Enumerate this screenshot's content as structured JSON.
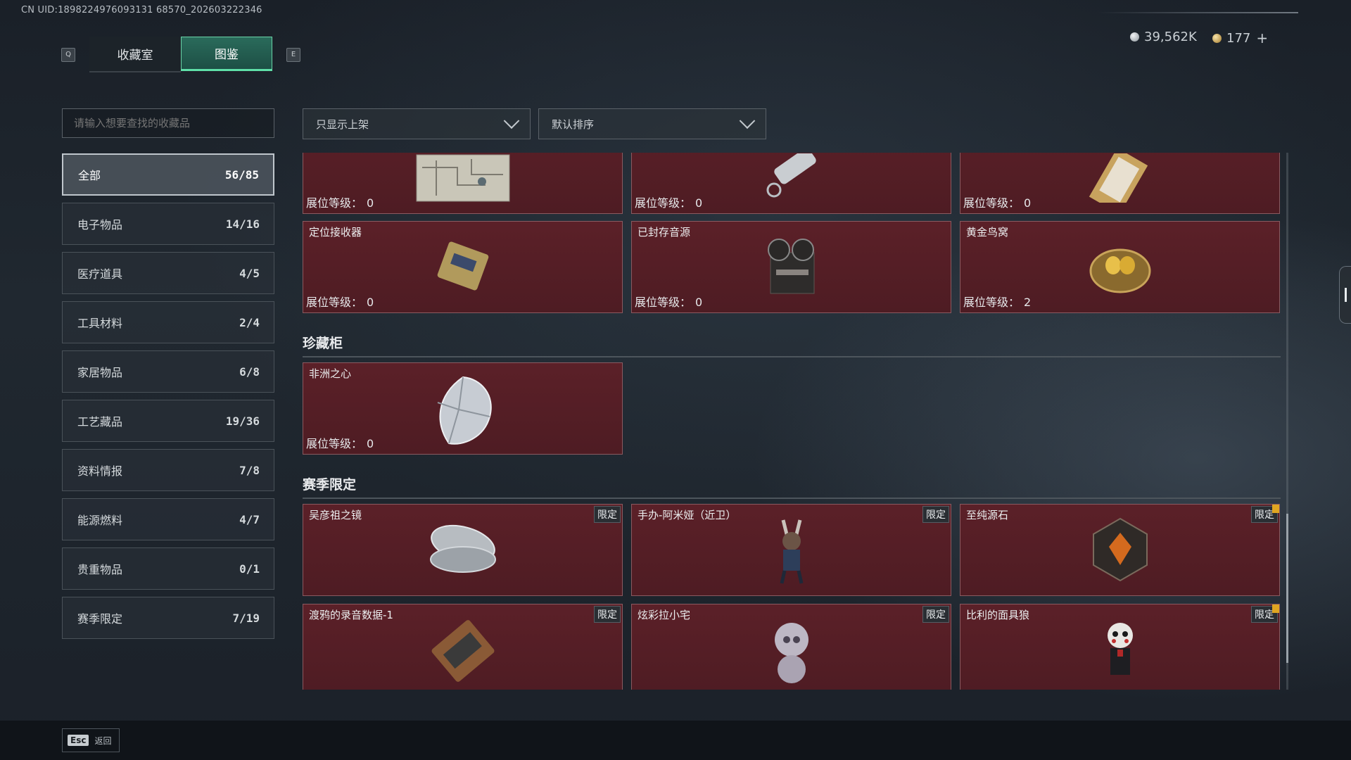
{
  "uid": "CN UID:1898224976093131 68570_202603222346",
  "keys": {
    "left": "Q",
    "right": "E",
    "esc": "Esc"
  },
  "tabs": [
    {
      "label": "收藏室"
    },
    {
      "label": "图鉴",
      "active": true
    }
  ],
  "currency": {
    "silver": "39,562K",
    "gold": "177",
    "plus": "+"
  },
  "search": {
    "placeholder": "请输入想要查找的收藏品"
  },
  "filters": {
    "display": "只显示上架",
    "sort": "默认排序"
  },
  "categories": [
    {
      "label": "全部",
      "count": "56/85",
      "active": true
    },
    {
      "label": "电子物品",
      "count": "14/16"
    },
    {
      "label": "医疗道具",
      "count": "4/5"
    },
    {
      "label": "工具材料",
      "count": "2/4"
    },
    {
      "label": "家居物品",
      "count": "6/8"
    },
    {
      "label": "工艺藏品",
      "count": "19/36"
    },
    {
      "label": "资料情报",
      "count": "7/8"
    },
    {
      "label": "能源燃料",
      "count": "4/7"
    },
    {
      "label": "贵重物品",
      "count": "0/1"
    },
    {
      "label": "赛季限定",
      "count": "7/19"
    }
  ],
  "level_label": "展位等级：",
  "limited_label": "限定",
  "top_row": [
    {
      "level": "0"
    },
    {
      "level": "0"
    },
    {
      "level": "0"
    }
  ],
  "row2": [
    {
      "name": "定位接收器",
      "level": "0"
    },
    {
      "name": "已封存音源",
      "level": "0"
    },
    {
      "name": "黄金鸟窝",
      "level": "2"
    }
  ],
  "section_cabinet": "珍藏柜",
  "cabinet": [
    {
      "name": "非洲之心",
      "level": "0"
    }
  ],
  "section_season": "赛季限定",
  "season": [
    {
      "name": "吴彦祖之镜"
    },
    {
      "name": "手办-阿米娅（近卫）"
    },
    {
      "name": "至纯源石"
    },
    {
      "name": "渡鸦的录音数据-1"
    },
    {
      "name": "炫彩拉小宅"
    },
    {
      "name": "比利的面具狼"
    }
  ],
  "footer": {
    "back_label": "返回"
  },
  "colors": {
    "card_bg": "#55202a",
    "accent_green": "#5fe0a8",
    "warn": "#e0a521"
  }
}
